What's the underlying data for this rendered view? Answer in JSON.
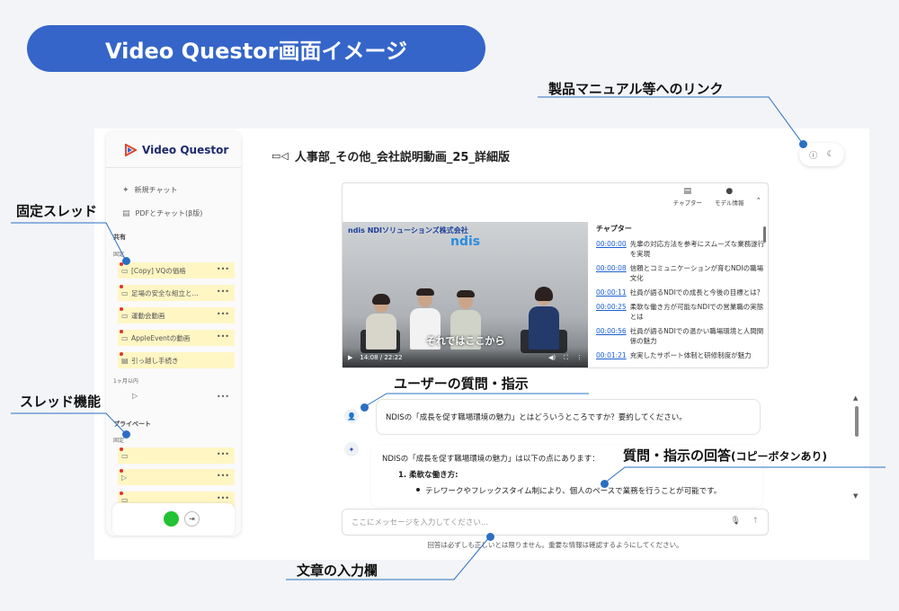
{
  "banner": {
    "title": "Video Questor画面イメージ"
  },
  "callouts": {
    "manual_link": "製品マニュアル等へのリンク",
    "pinned_threads": "固定スレッド",
    "thread_function": "スレッド機能",
    "user_question": "ユーザーの質問・指示",
    "answer_main": "質問・指示の回答",
    "answer_sub": "(コピーボタンあり)",
    "input_field": "文章の入力欄"
  },
  "sidebar": {
    "logo_text": "Video Questor",
    "new_chat": "新規チャット",
    "pdf_chat": "PDFとチャット(β版)",
    "shared_label": "共有",
    "pinned_label": "固定",
    "pinned_threads": [
      {
        "label": "[Copy] VQの価格"
      },
      {
        "label": "足場の安全な組立と..."
      },
      {
        "label": "運動会動画"
      },
      {
        "label": "AppleEventの動画"
      },
      {
        "label": "引っ越し手続き"
      }
    ],
    "month_label": "1ヶ月以内",
    "private_label": "プライベート",
    "private_sub_label": "固定",
    "more_icon": "•••"
  },
  "main": {
    "title": "人事部_その他_会社説明動画_25_詳細版",
    "tools": [
      {
        "label": "チャプター",
        "icon": "document-icon"
      },
      {
        "label": "モデル情報",
        "icon": "info-icon"
      }
    ]
  },
  "video": {
    "brand": "ndis NDIソリューションズ株式会社",
    "logo": "ndis",
    "caption": "それではここから",
    "time": "14:08 / 22:22"
  },
  "chapters": {
    "heading": "チャプター",
    "items": [
      {
        "ts": "00:00:00",
        "text": "先輩の対応方法を参考にスムーズな業務遂行を実現"
      },
      {
        "ts": "00:00:08",
        "text": "信頼とコミュニケーションが育むNDIの職場文化"
      },
      {
        "ts": "00:00:11",
        "text": "社員が語るNDIでの成長と今後の目標とは？"
      },
      {
        "ts": "00:00:25",
        "text": "柔軟な働き方が可能なNDIでの営業職の実態とは"
      },
      {
        "ts": "00:00:56",
        "text": "社員が語るNDIでの温かい職場環境と人間関係の魅力"
      },
      {
        "ts": "00:01:21",
        "text": "充実したサポート体制と研修制度が魅力"
      }
    ]
  },
  "chat": {
    "user_message": "NDISの「成長を促す職場環境の魅力」とはどういうところですか？要約してください。",
    "answer_intro": "NDISの「成長を促す職場環境の魅力」は以下の点にあります：",
    "answer_item1": "1. 柔軟な働き方:",
    "answer_bullet1": "テレワークやフレックスタイム制により、個人のペースで業務を行うことが可能です。"
  },
  "input": {
    "placeholder": "ここにメッセージを入力してください...",
    "disclaimer": "回答は必ずしも正しいとは限りません。重要な情報は確認するようにしてください。"
  },
  "colors": {
    "banner": "#3565c8",
    "accent": "#2a6fc0",
    "pinned_bg": "#fff6c4",
    "online": "#22c232"
  }
}
